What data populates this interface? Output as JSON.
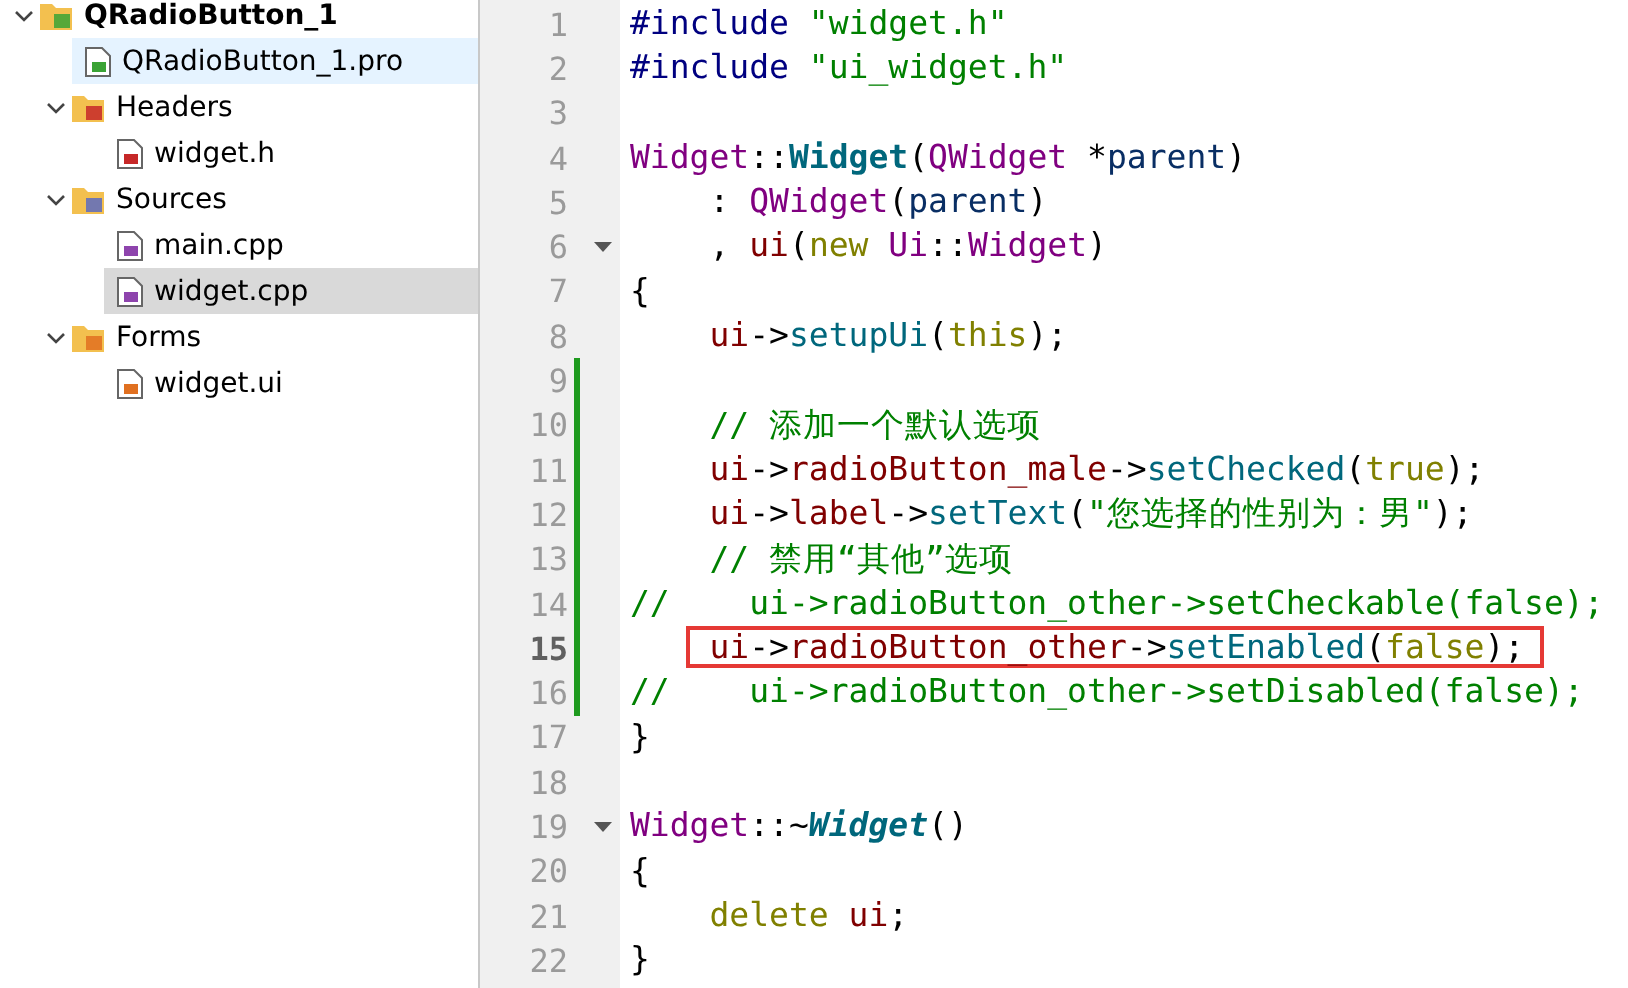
{
  "project_tree": [
    {
      "label": "QRadioButton_1",
      "kind": "project",
      "expanded": true,
      "selected": false,
      "hovered": false,
      "children": [
        {
          "label": "QRadioButton_1.pro",
          "kind": "pro-file",
          "selected": false,
          "hovered": true
        },
        {
          "label": "Headers",
          "kind": "header-folder",
          "expanded": true,
          "selected": false,
          "hovered": false,
          "children": [
            {
              "label": "widget.h",
              "kind": "header-file",
              "selected": false,
              "hovered": false
            }
          ]
        },
        {
          "label": "Sources",
          "kind": "source-folder",
          "expanded": true,
          "selected": false,
          "hovered": false,
          "children": [
            {
              "label": "main.cpp",
              "kind": "source-file",
              "selected": false,
              "hovered": false
            },
            {
              "label": "widget.cpp",
              "kind": "source-file",
              "selected": true,
              "hovered": false
            }
          ]
        },
        {
          "label": "Forms",
          "kind": "form-folder",
          "expanded": true,
          "selected": false,
          "hovered": false,
          "children": [
            {
              "label": "widget.ui",
              "kind": "form-file",
              "selected": false,
              "hovered": false
            }
          ]
        }
      ]
    }
  ],
  "editor": {
    "lines": [
      {
        "number": "1",
        "changed": false,
        "foldable": false,
        "current": false,
        "boxed": false,
        "tokens": [
          {
            "text": "#include",
            "kind": "pre"
          },
          {
            "text": " \"widget.h\"",
            "kind": "str"
          }
        ]
      },
      {
        "number": "2",
        "changed": false,
        "foldable": false,
        "current": false,
        "boxed": false,
        "tokens": [
          {
            "text": "#include",
            "kind": "pre"
          },
          {
            "text": " \"ui_widget.h\"",
            "kind": "str"
          }
        ]
      },
      {
        "number": "3",
        "changed": false,
        "foldable": false,
        "current": false
      },
      {
        "number": "4",
        "changed": false,
        "foldable": false,
        "current": false,
        "boxed": false,
        "tokens": [
          {
            "text": "Widget",
            "kind": "type"
          },
          {
            "text": "::",
            "kind": "plain"
          },
          {
            "text": "Widget",
            "kind": "ctor"
          },
          {
            "text": "(",
            "kind": "plain"
          },
          {
            "text": "QWidget",
            "kind": "type"
          },
          {
            "text": " *",
            "kind": "plain"
          },
          {
            "text": "parent",
            "kind": "param"
          },
          {
            "text": ")",
            "kind": "plain"
          }
        ]
      },
      {
        "number": "5",
        "changed": false,
        "foldable": false,
        "current": false,
        "boxed": false,
        "tokens": [
          {
            "text": "    : ",
            "kind": "plain"
          },
          {
            "text": "QWidget",
            "kind": "type"
          },
          {
            "text": "(",
            "kind": "plain"
          },
          {
            "text": "parent",
            "kind": "param"
          },
          {
            "text": ")",
            "kind": "plain"
          }
        ]
      },
      {
        "number": "6",
        "changed": false,
        "foldable": true,
        "current": false,
        "boxed": false,
        "tokens": [
          {
            "text": "    , ",
            "kind": "plain"
          },
          {
            "text": "ui",
            "kind": "member"
          },
          {
            "text": "(",
            "kind": "plain"
          },
          {
            "text": "new",
            "kind": "kw"
          },
          {
            "text": " Ui",
            "kind": "type"
          },
          {
            "text": "::",
            "kind": "plain"
          },
          {
            "text": "Widget",
            "kind": "type"
          },
          {
            "text": ")",
            "kind": "plain"
          }
        ]
      },
      {
        "number": "7",
        "changed": false,
        "foldable": false,
        "current": false,
        "boxed": false,
        "tokens": [
          {
            "text": "{",
            "kind": "plain"
          }
        ]
      },
      {
        "number": "8",
        "changed": false,
        "foldable": false,
        "current": false,
        "boxed": false,
        "tokens": [
          {
            "text": "    ui",
            "kind": "member"
          },
          {
            "text": "->",
            "kind": "plain"
          },
          {
            "text": "setupUi",
            "kind": "fn"
          },
          {
            "text": "(",
            "kind": "plain"
          },
          {
            "text": "this",
            "kind": "kw"
          },
          {
            "text": ");",
            "kind": "plain"
          }
        ]
      },
      {
        "number": "9",
        "changed": true,
        "foldable": false,
        "current": false
      },
      {
        "number": "10",
        "changed": true,
        "foldable": false,
        "current": false,
        "boxed": false,
        "tokens": [
          {
            "text": "    // 添加一个默认选项",
            "kind": "comment"
          }
        ]
      },
      {
        "number": "11",
        "changed": true,
        "foldable": false,
        "current": false,
        "boxed": false,
        "tokens": [
          {
            "text": "    ui",
            "kind": "member"
          },
          {
            "text": "->",
            "kind": "plain"
          },
          {
            "text": "radioButton_male",
            "kind": "member"
          },
          {
            "text": "->",
            "kind": "plain"
          },
          {
            "text": "setChecked",
            "kind": "fn"
          },
          {
            "text": "(",
            "kind": "plain"
          },
          {
            "text": "true",
            "kind": "kw"
          },
          {
            "text": ");",
            "kind": "plain"
          }
        ]
      },
      {
        "number": "12",
        "changed": true,
        "foldable": false,
        "current": false,
        "boxed": false,
        "tokens": [
          {
            "text": "    ui",
            "kind": "member"
          },
          {
            "text": "->",
            "kind": "plain"
          },
          {
            "text": "label",
            "kind": "member"
          },
          {
            "text": "->",
            "kind": "plain"
          },
          {
            "text": "setText",
            "kind": "fn"
          },
          {
            "text": "(",
            "kind": "plain"
          },
          {
            "text": "\"您选择的性别为：男\"",
            "kind": "str"
          },
          {
            "text": ");",
            "kind": "plain"
          }
        ]
      },
      {
        "number": "13",
        "changed": true,
        "foldable": false,
        "current": false,
        "boxed": false,
        "tokens": [
          {
            "text": "    // 禁用“其他”选项",
            "kind": "comment"
          }
        ]
      },
      {
        "number": "14",
        "changed": true,
        "foldable": false,
        "current": false,
        "boxed": false,
        "tokens": [
          {
            "text": "//    ui->radioButton_other->setCheckable(false);",
            "kind": "comment"
          }
        ]
      },
      {
        "number": "15",
        "changed": true,
        "foldable": false,
        "current": true,
        "boxed": true,
        "tokens": [
          {
            "text": "    ui",
            "kind": "member"
          },
          {
            "text": "->",
            "kind": "plain"
          },
          {
            "text": "radioButton_other",
            "kind": "member"
          },
          {
            "text": "->",
            "kind": "plain"
          },
          {
            "text": "setEnabled",
            "kind": "fn"
          },
          {
            "text": "(",
            "kind": "plain"
          },
          {
            "text": "false",
            "kind": "kw"
          },
          {
            "text": ");",
            "kind": "plain"
          }
        ]
      },
      {
        "number": "16",
        "changed": true,
        "foldable": false,
        "current": false,
        "boxed": false,
        "tokens": [
          {
            "text": "//    ui->radioButton_other->setDisabled(false);",
            "kind": "comment"
          }
        ]
      },
      {
        "number": "17",
        "changed": false,
        "foldable": false,
        "current": false,
        "boxed": false,
        "tokens": [
          {
            "text": "}",
            "kind": "plain"
          }
        ]
      },
      {
        "number": "18",
        "changed": false,
        "foldable": false,
        "current": false
      },
      {
        "number": "19",
        "changed": false,
        "foldable": true,
        "current": false,
        "boxed": false,
        "tokens": [
          {
            "text": "Widget",
            "kind": "type"
          },
          {
            "text": "::~",
            "kind": "plain"
          },
          {
            "text": "Widget",
            "kind": "dtor"
          },
          {
            "text": "()",
            "kind": "plain"
          }
        ]
      },
      {
        "number": "20",
        "changed": false,
        "foldable": false,
        "current": false,
        "boxed": false,
        "tokens": [
          {
            "text": "{",
            "kind": "plain"
          }
        ]
      },
      {
        "number": "21",
        "changed": false,
        "foldable": false,
        "current": false,
        "boxed": false,
        "tokens": [
          {
            "text": "    delete",
            "kind": "kw"
          },
          {
            "text": " ui",
            "kind": "member"
          },
          {
            "text": ";",
            "kind": "plain"
          }
        ]
      },
      {
        "number": "22",
        "changed": false,
        "foldable": false,
        "current": false,
        "boxed": false,
        "tokens": [
          {
            "text": "}",
            "kind": "plain"
          }
        ]
      }
    ]
  }
}
